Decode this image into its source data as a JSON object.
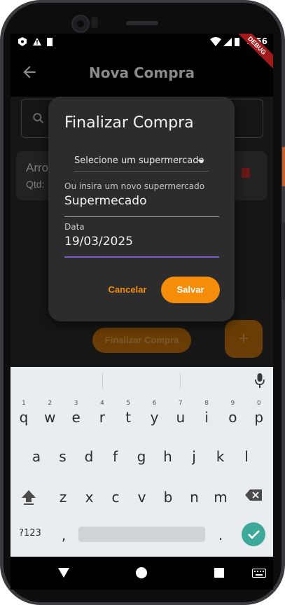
{
  "status_bar": {
    "time": "9:56"
  },
  "debug_banner": "DEBUG",
  "app_bar": {
    "title": "Nova Compra"
  },
  "background_list": {
    "item_name": "Arro",
    "item_qty": "Qtd:"
  },
  "background_buttons": {
    "finalizar": "Finalizar Compra",
    "fab": "+"
  },
  "dialog": {
    "title": "Finalizar Compra",
    "dropdown_value": "Selecione um supermercado",
    "new_market_label": "Ou insira um novo supermercado",
    "new_market_value": "Supermecado",
    "date_label": "Data",
    "date_value": "19/03/2025",
    "cancel_label": "Cancelar",
    "save_label": "Salvar"
  },
  "keyboard": {
    "row1": [
      "q",
      "w",
      "e",
      "r",
      "t",
      "y",
      "u",
      "i",
      "o",
      "p"
    ],
    "row1_hints": [
      "1",
      "2",
      "3",
      "4",
      "5",
      "6",
      "7",
      "8",
      "9",
      "0"
    ],
    "row2": [
      "a",
      "s",
      "d",
      "f",
      "g",
      "h",
      "j",
      "k",
      "l"
    ],
    "row3": [
      "z",
      "x",
      "c",
      "v",
      "b",
      "n",
      "m"
    ],
    "symbols_key": "?123",
    "comma": ",",
    "period": "."
  },
  "colors": {
    "accent": "#f58c0a",
    "focus_line": "#7b5fc4",
    "enter_key": "#3ea89a"
  }
}
